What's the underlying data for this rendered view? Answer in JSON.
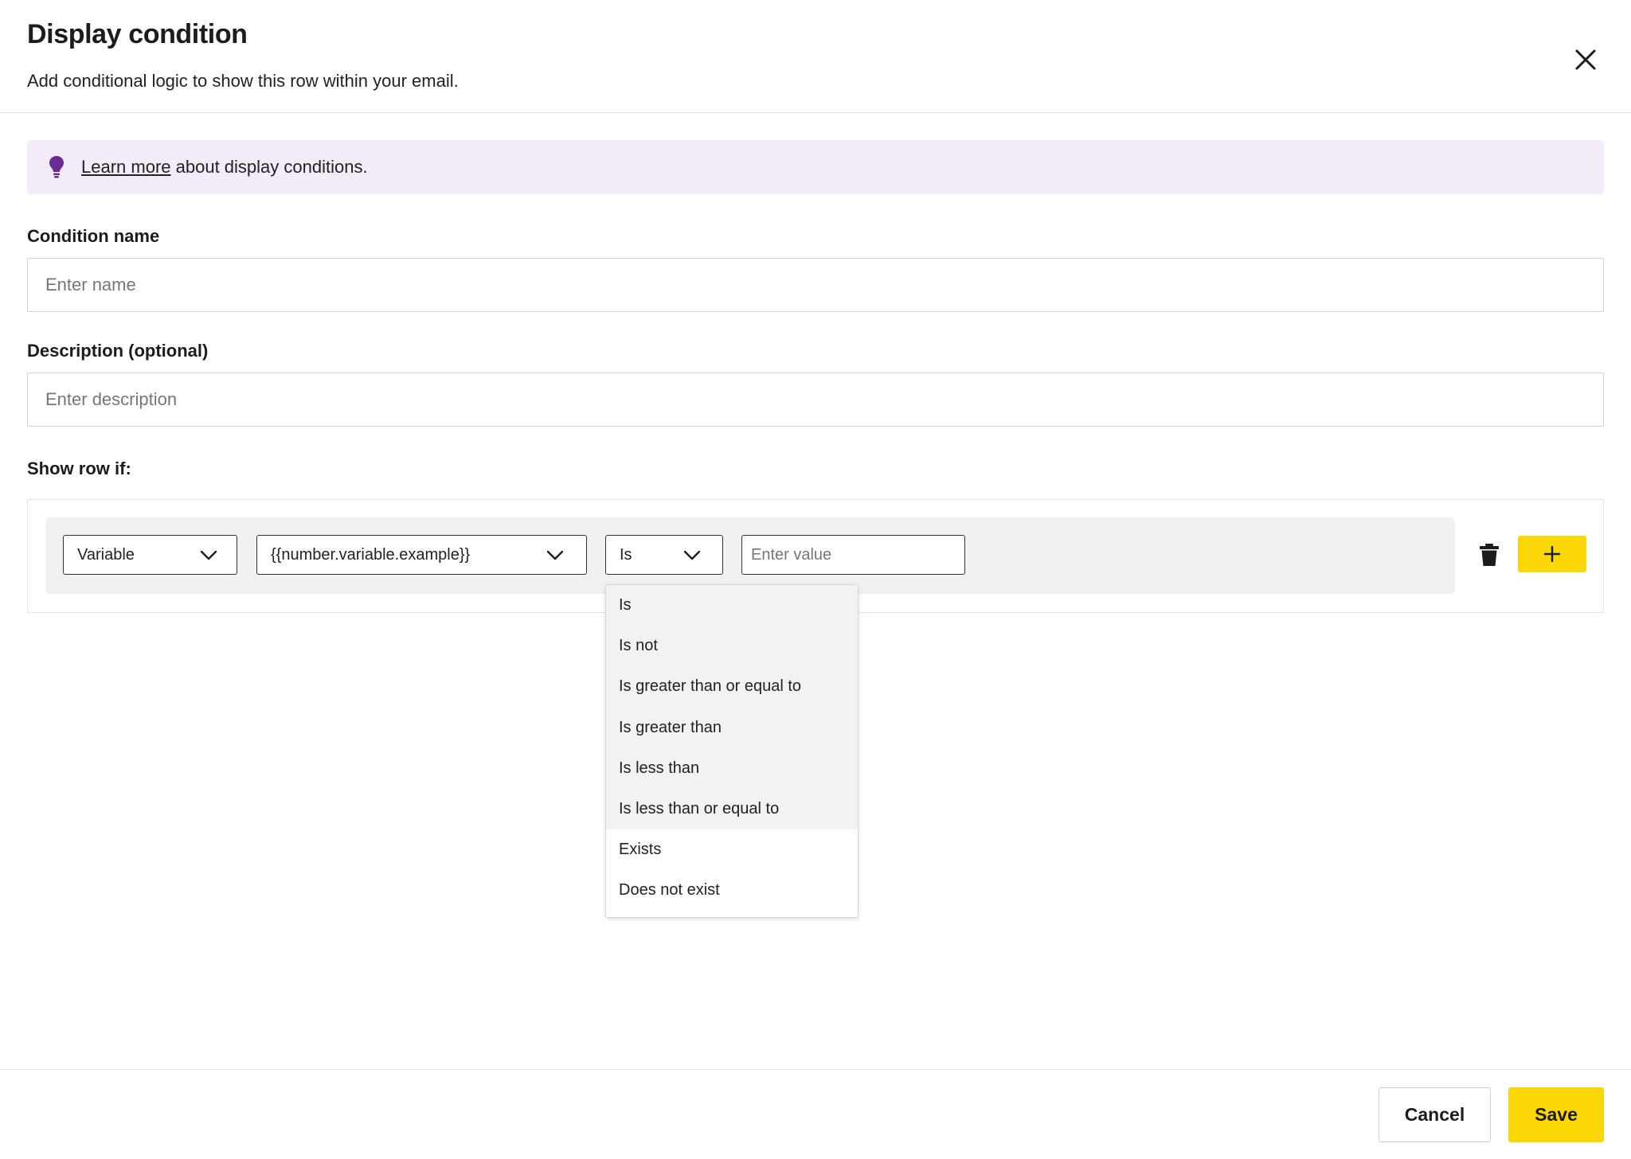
{
  "dialog": {
    "title": "Display condition",
    "subtitle": "Add conditional logic to show this row within your email."
  },
  "banner": {
    "link_text": "Learn more",
    "text": " about display conditions.",
    "icon": "lightbulb-icon",
    "background_color": "#f4ebf8",
    "icon_color": "#6b2c91"
  },
  "form": {
    "condition_name": {
      "label": "Condition name",
      "placeholder": "Enter name",
      "value": ""
    },
    "description": {
      "label": "Description (optional)",
      "placeholder": "Enter description",
      "value": ""
    },
    "show_row_label": "Show row if:"
  },
  "condition": {
    "type_select": "Variable",
    "variable_select": "{{number.variable.example}}",
    "operator_select": "Is",
    "value_placeholder": "Enter value",
    "value": ""
  },
  "operator_menu": {
    "items": [
      "Is",
      "Is not",
      "Is greater than or equal to",
      "Is greater than",
      "Is less than",
      "Is less than or equal to",
      "Exists",
      "Does not exist"
    ]
  },
  "footer": {
    "cancel_label": "Cancel",
    "save_label": "Save"
  },
  "colors": {
    "accent_yellow": "#fad705",
    "row_background": "#f0f1f0",
    "text": "#1c1c1c"
  }
}
